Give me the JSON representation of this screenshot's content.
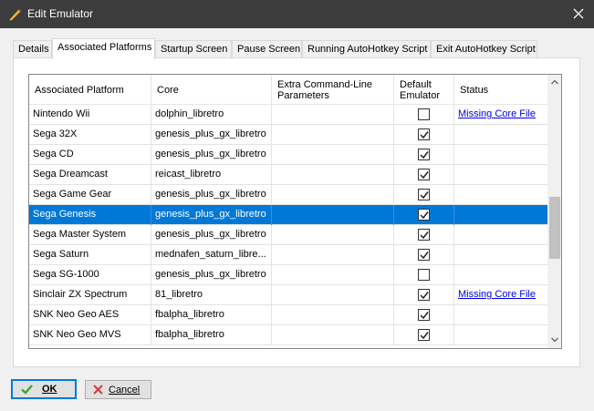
{
  "window": {
    "title": "Edit Emulator"
  },
  "tabs": [
    {
      "label": "Details"
    },
    {
      "label": "Associated Platforms"
    },
    {
      "label": "Startup Screen"
    },
    {
      "label": "Pause Screen"
    },
    {
      "label": "Running AutoHotkey Script"
    },
    {
      "label": "Exit AutoHotkey Script"
    }
  ],
  "active_tab": "Associated Platforms",
  "grid": {
    "columns": [
      {
        "label": "Associated Platform"
      },
      {
        "label": "Core"
      },
      {
        "label": "Extra Command-Line Parameters"
      },
      {
        "label": "Default Emulator"
      },
      {
        "label": "Status"
      }
    ],
    "rows": [
      {
        "platform": "Nintendo Wii",
        "core": "dolphin_libretro",
        "params": "",
        "default": false,
        "status": "Missing Core File"
      },
      {
        "platform": "Sega 32X",
        "core": "genesis_plus_gx_libretro",
        "params": "",
        "default": true,
        "status": ""
      },
      {
        "platform": "Sega CD",
        "core": "genesis_plus_gx_libretro",
        "params": "",
        "default": true,
        "status": ""
      },
      {
        "platform": "Sega Dreamcast",
        "core": "reicast_libretro",
        "params": "",
        "default": true,
        "status": ""
      },
      {
        "platform": "Sega Game Gear",
        "core": "genesis_plus_gx_libretro",
        "params": "",
        "default": true,
        "status": ""
      },
      {
        "platform": "Sega Genesis",
        "core": "genesis_plus_gx_libretro",
        "params": "",
        "default": true,
        "status": "",
        "selected": true
      },
      {
        "platform": "Sega Master System",
        "core": "genesis_plus_gx_libretro",
        "params": "",
        "default": true,
        "status": ""
      },
      {
        "platform": "Sega Saturn",
        "core": "mednafen_saturn_libre...",
        "params": "",
        "default": true,
        "status": ""
      },
      {
        "platform": "Sega SG-1000",
        "core": "genesis_plus_gx_libretro",
        "params": "",
        "default": false,
        "status": ""
      },
      {
        "platform": "Sinclair ZX Spectrum",
        "core": "81_libretro",
        "params": "",
        "default": true,
        "status": "Missing Core File"
      },
      {
        "platform": "SNK Neo Geo AES",
        "core": "fbalpha_libretro",
        "params": "",
        "default": true,
        "status": ""
      },
      {
        "platform": "SNK Neo Geo MVS",
        "core": "fbalpha_libretro",
        "params": "",
        "default": true,
        "status": ""
      }
    ]
  },
  "buttons": {
    "ok_label": "OK",
    "cancel_label": "Cancel"
  },
  "colors": {
    "titlebar": "#3c3c3c",
    "selection": "#0078d7",
    "link": "#0000ee"
  }
}
